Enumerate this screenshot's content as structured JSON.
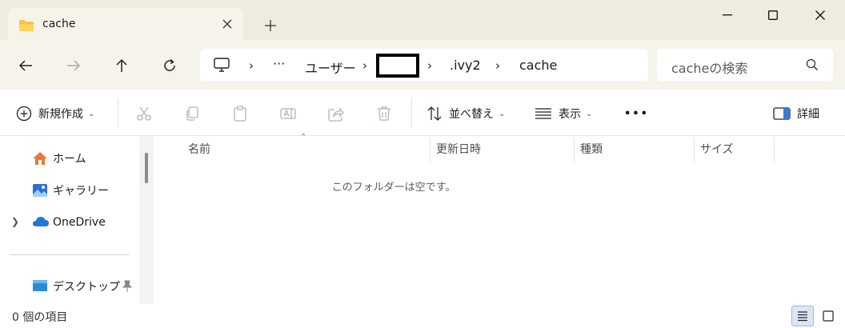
{
  "tab": {
    "title": "cache",
    "close_icon": "close-icon",
    "newtab_icon": "plus-icon"
  },
  "window": {
    "minimize": "minimize-icon",
    "maximize": "maximize-icon",
    "close": "close-icon"
  },
  "nav": {
    "back": "arrow-left-icon",
    "forward": "arrow-right-icon",
    "up": "arrow-up-icon",
    "refresh": "refresh-icon"
  },
  "breadcrumb": {
    "computer_icon": "monitor-icon",
    "ellipsis": "···",
    "items": [
      "ユーザー",
      ".ivy2",
      "cache"
    ],
    "sep": "›"
  },
  "search": {
    "placeholder": "cacheの検索"
  },
  "toolbar": {
    "new_label": "新規作成",
    "sort_label": "並べ替え",
    "view_label": "表示",
    "more": "•••",
    "details_label": "詳細"
  },
  "sidebar": {
    "items": [
      {
        "label": "ホーム",
        "icon": "home-icon"
      },
      {
        "label": "ギャラリー",
        "icon": "gallery-icon"
      },
      {
        "label": "OneDrive",
        "icon": "cloud-icon"
      },
      {
        "label": "デスクトップ",
        "icon": "desktop-icon"
      }
    ]
  },
  "columns": [
    "名前",
    "更新日時",
    "種類",
    "サイズ"
  ],
  "empty_message": "このフォルダーは空です。",
  "status": {
    "count_text": "0 個の項目"
  }
}
